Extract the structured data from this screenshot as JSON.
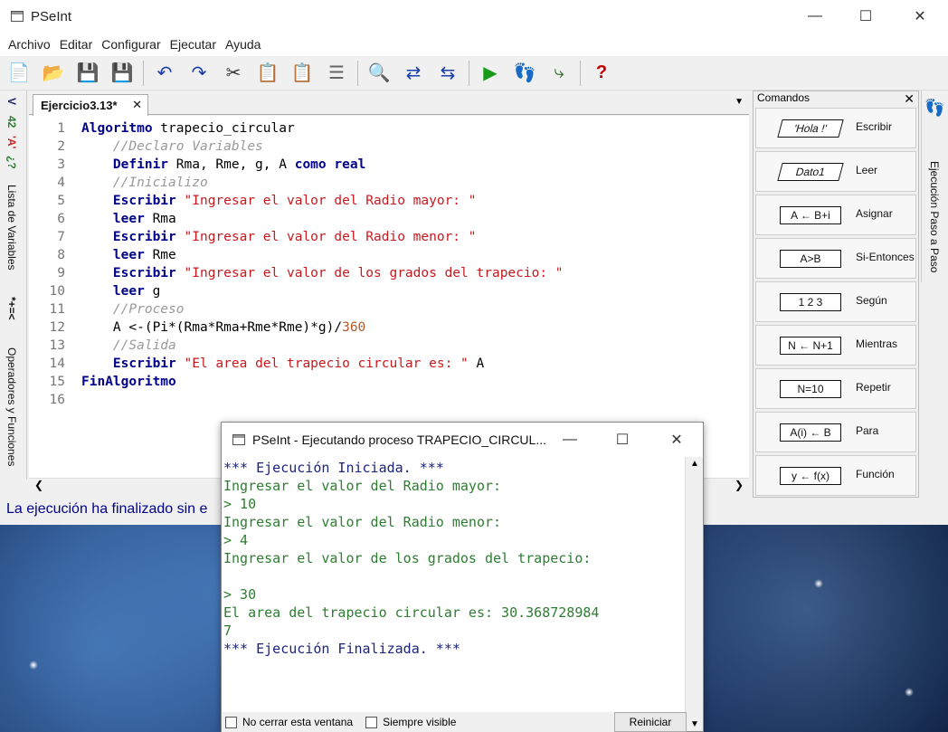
{
  "app": {
    "title": "PSeInt"
  },
  "menu": [
    "Archivo",
    "Editar",
    "Configurar",
    "Ejecutar",
    "Ayuda"
  ],
  "left_strip": {
    "labels": [
      "Lista de Variables",
      "Operadores y Funciones"
    ]
  },
  "right_strip": {
    "label": "Ejecución Paso a Paso"
  },
  "editor": {
    "tab_label": "Ejercicio3.13*",
    "lines": [
      {
        "n": "1",
        "text": "Algoritmo trapecio_circular"
      },
      {
        "n": "2",
        "text": "    //Declaro Variables"
      },
      {
        "n": "3",
        "text": "    Definir Rma, Rme, g, A como real"
      },
      {
        "n": "4",
        "text": "    //Inicializo"
      },
      {
        "n": "5",
        "text": "    Escribir \"Ingresar el valor del Radio mayor: \""
      },
      {
        "n": "6",
        "text": "    leer Rma"
      },
      {
        "n": "7",
        "text": "    Escribir \"Ingresar el valor del Radio menor: \""
      },
      {
        "n": "8",
        "text": "    leer Rme"
      },
      {
        "n": "9",
        "text": "    Escribir \"Ingresar el valor de los grados del trapecio: \""
      },
      {
        "n": "10",
        "text": "    leer g"
      },
      {
        "n": "11",
        "text": "    //Proceso"
      },
      {
        "n": "12",
        "text": "    A <-(Pi*(Rma*Rma+Rme*Rme)*g)/360"
      },
      {
        "n": "13",
        "text": "    //Salida"
      },
      {
        "n": "14",
        "text": "    Escribir \"El area del trapecio circular es: \" A"
      },
      {
        "n": "15",
        "text": "FinAlgoritmo"
      },
      {
        "n": "16",
        "text": ""
      }
    ]
  },
  "status": {
    "text": "La ejecución ha finalizado sin e"
  },
  "commands": {
    "title": "Comandos",
    "items": [
      {
        "label": "Escribir",
        "shape": "'Hola !'"
      },
      {
        "label": "Leer",
        "shape": "Dato1"
      },
      {
        "label": "Asignar",
        "shape": "A ← B+i"
      },
      {
        "label": "Si-Entonces",
        "shape": "A>B"
      },
      {
        "label": "Según",
        "shape": "1 2 3"
      },
      {
        "label": "Mientras",
        "shape": "N ← N+1"
      },
      {
        "label": "Repetir",
        "shape": "N=10"
      },
      {
        "label": "Para",
        "shape": "A(i) ← B"
      },
      {
        "label": "Función",
        "shape": "y ← f(x)"
      }
    ]
  },
  "exec_window": {
    "title": "PSeInt - Ejecutando proceso TRAPECIO_CIRCUL...",
    "output": [
      {
        "text": "*** Ejecución Iniciada. ***",
        "type": "hl"
      },
      {
        "text": "Ingresar el valor del Radio mayor:",
        "type": "out"
      },
      {
        "text": "> 10",
        "type": "out"
      },
      {
        "text": "Ingresar el valor del Radio menor:",
        "type": "out"
      },
      {
        "text": "> 4",
        "type": "out"
      },
      {
        "text": "Ingresar el valor de los grados del trapecio:",
        "type": "out"
      },
      {
        "text": "",
        "type": "out"
      },
      {
        "text": "> 30",
        "type": "out"
      },
      {
        "text": "El area del trapecio circular es: 30.368728984",
        "type": "out"
      },
      {
        "text": "7",
        "type": "out"
      },
      {
        "text": "*** Ejecución Finalizada. ***",
        "type": "hl"
      }
    ],
    "checkbox_close": "No cerrar esta ventana",
    "checkbox_visible": "Siempre visible",
    "restart_label": "Reiniciar"
  }
}
